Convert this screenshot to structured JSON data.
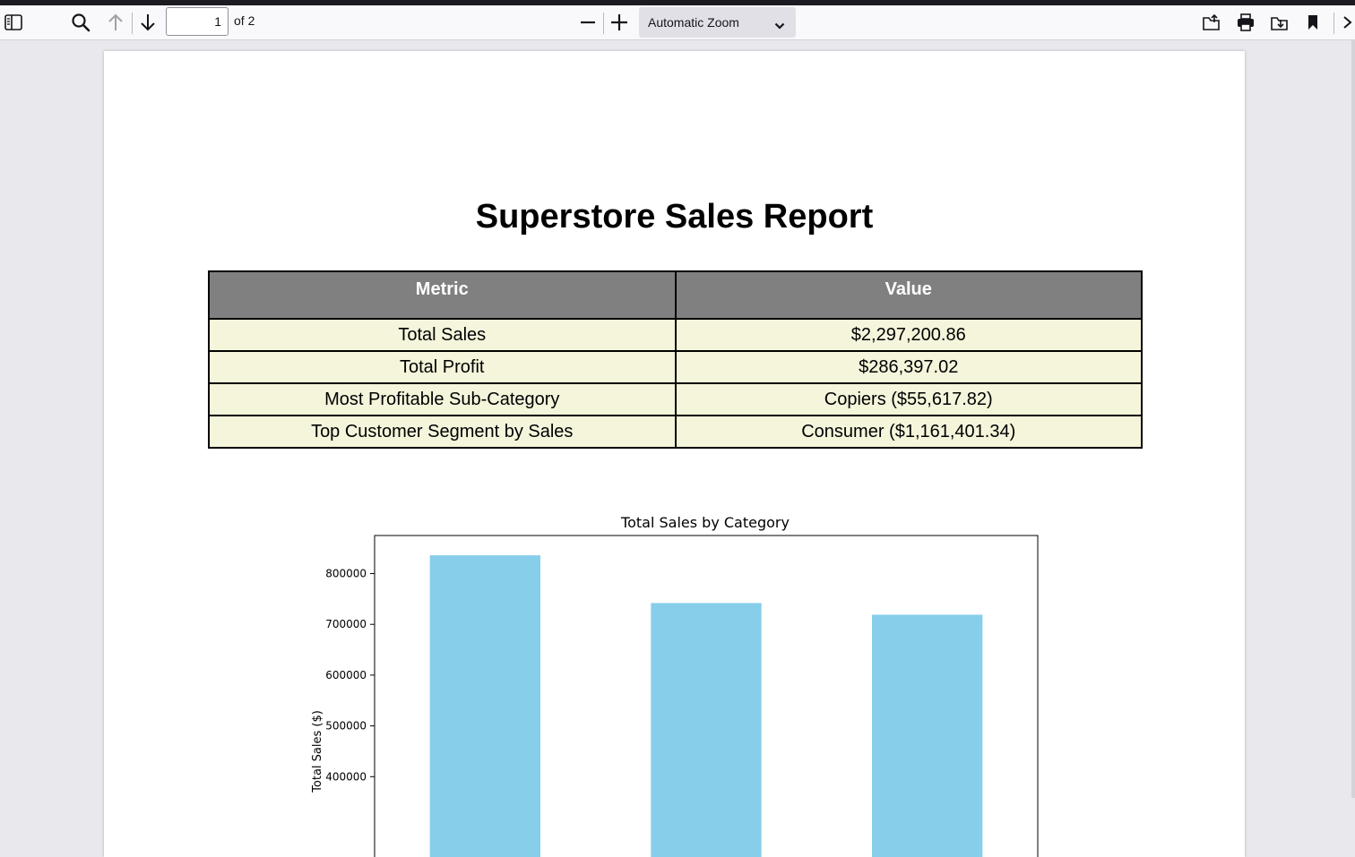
{
  "toolbar": {
    "current_page": "1",
    "page_count_label": "of 2",
    "zoom_label": "Automatic Zoom"
  },
  "document": {
    "title": "Superstore Sales Report",
    "table": {
      "headers": [
        "Metric",
        "Value"
      ],
      "rows": [
        [
          "Total Sales",
          "$2,297,200.86"
        ],
        [
          "Total Profit",
          "$286,397.02"
        ],
        [
          "Most Profitable Sub-Category",
          "Copiers ($55,617.82)"
        ],
        [
          "Top Customer Segment by Sales",
          "Consumer ($1,161,401.34)"
        ]
      ]
    }
  },
  "chart_data": {
    "type": "bar",
    "title": "Total Sales by Category",
    "xlabel": "",
    "ylabel": "Total Sales ($)",
    "categories": [
      "",
      "",
      ""
    ],
    "values": [
      836000,
      742000,
      719000
    ],
    "ylim": [
      240000,
      875000
    ],
    "yticks": [
      400000,
      500000,
      600000,
      700000,
      800000
    ],
    "bar_color": "#87ceeb",
    "grid": false
  },
  "colors": {
    "header_bg": "#808080",
    "row_bg": "#f5f5dc",
    "toolbar_bg": "#f9f9fb"
  }
}
